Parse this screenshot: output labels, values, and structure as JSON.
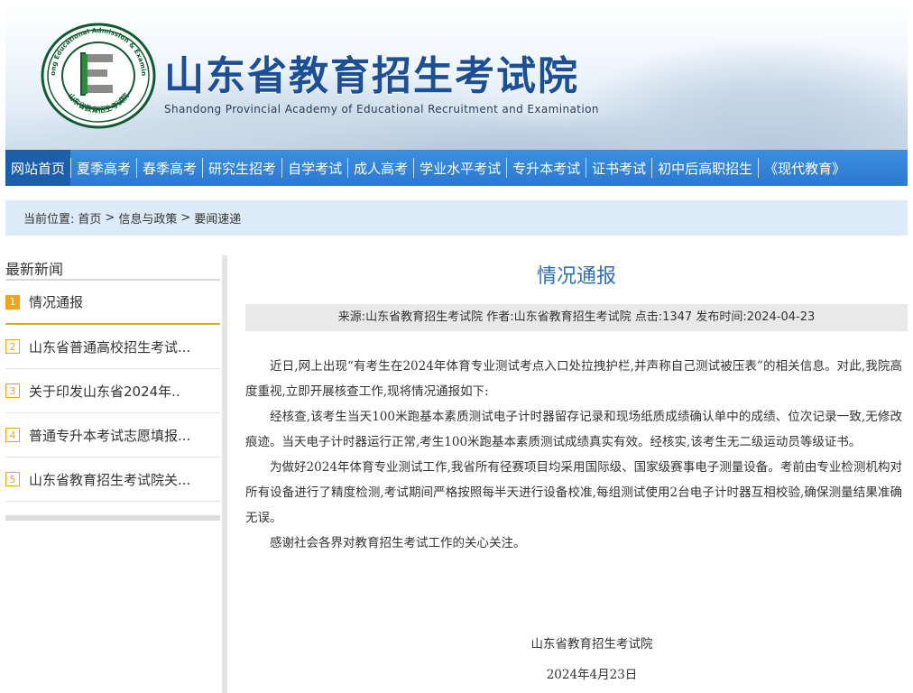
{
  "header": {
    "title_cn": "山东省教育招生考试院",
    "title_en": "Shandong Provincial Academy of Educational Recruitment and Examination",
    "logo_icon": "academy-seal-logo",
    "logo_ring_text": "Shandong Educational Admission & Examinations",
    "logo_bottom_text": "山东省教育招生考试院"
  },
  "nav": {
    "items": [
      {
        "label": "网站首页",
        "active": true
      },
      {
        "label": "夏季高考"
      },
      {
        "label": "春季高考"
      },
      {
        "label": "研究生招考"
      },
      {
        "label": "自学考试"
      },
      {
        "label": "成人高考"
      },
      {
        "label": "学业水平考试"
      },
      {
        "label": "专升本考试"
      },
      {
        "label": "证书考试"
      },
      {
        "label": "初中后高职招生"
      },
      {
        "label": "《现代教育》"
      }
    ]
  },
  "breadcrumb": {
    "prefix": "当前位置:",
    "items": [
      "首页",
      "信息与政策",
      "要闻速递"
    ],
    "separator": ">"
  },
  "sidebar": {
    "heading": "最新新闻",
    "items": [
      {
        "num": "1",
        "label": "情况通报"
      },
      {
        "num": "2",
        "label": "山东省普通高校招生考试..."
      },
      {
        "num": "3",
        "label": "关于印发山东省2024年.."
      },
      {
        "num": "4",
        "label": "普通专升本考试志愿填报..."
      },
      {
        "num": "5",
        "label": "山东省教育招生考试院关..."
      }
    ]
  },
  "article": {
    "title": "情况通报",
    "meta": "来源:山东省教育招生考试院 作者:山东省教育招生考试院 点击:1347 发布时间:2024-04-23",
    "paragraphs": [
      "近日,网上出现“有考生在2024年体育专业测试考点入口处拉拽护栏,并声称自己测试被压表”的相关信息。对此,我院高度重视,立即开展核查工作,现将情况通报如下:",
      "经核查,该考生当天100米跑基本素质测试电子计时器留存记录和现场纸质成绩确认单中的成绩、位次记录一致,无修改痕迹。当天电子计时器运行正常,考生100米跑基本素质测试成绩真实有效。经核实,该考生无二级运动员等级证书。",
      "为做好2024年体育专业测试工作,我省所有径赛项目均采用国际级、国家级赛事电子测量设备。考前由专业检测机构对所有设备进行了精度检测,考试期间严格按照每半天进行设备校准,每组测试使用2台电子计时器互相校验,确保测量结果准确无误。",
      "感谢社会各界对教育招生考试工作的关心关注。"
    ],
    "signature": "山东省教育招生考试院",
    "date": "2024年4月23日"
  },
  "colors": {
    "nav_bg": "#2c79cf",
    "nav_active": "#1d5ea9",
    "title_blue": "#2f6fb8",
    "accent_orange": "#f0a31d",
    "crumb_bg": "#ddebf8"
  }
}
